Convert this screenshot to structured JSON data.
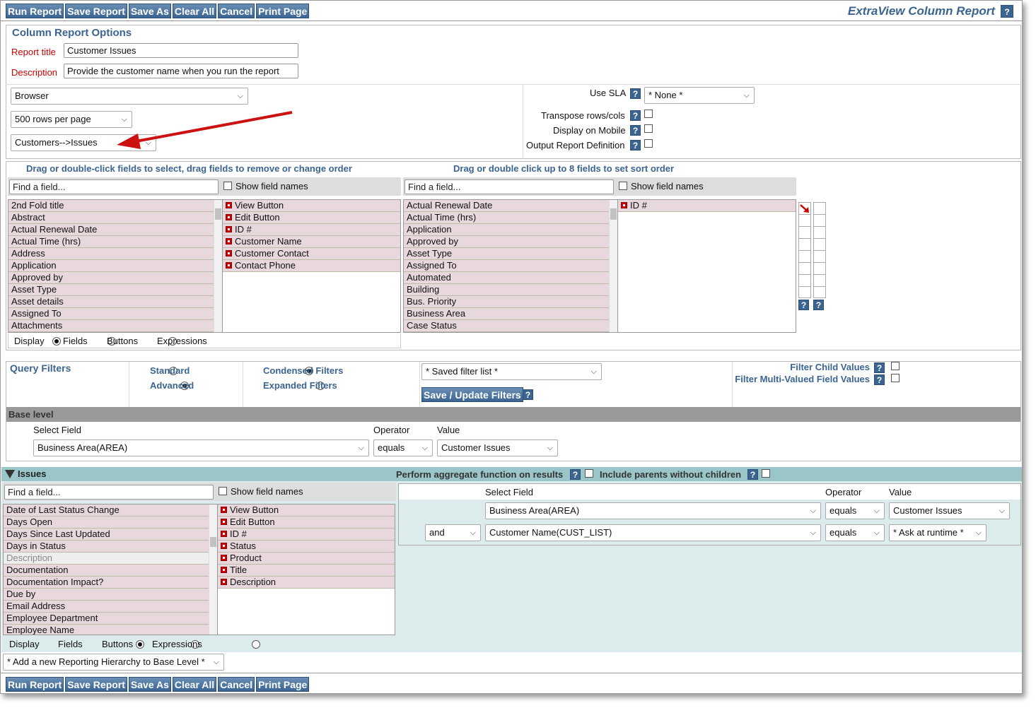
{
  "toolbar": {
    "run": "Run Report",
    "save": "Save Report",
    "saveas": "Save As",
    "clear": "Clear All",
    "cancel": "Cancel",
    "print": "Print Page"
  },
  "app_title": "ExtraView Column Report",
  "help": "?",
  "options": {
    "heading": "Column Report Options",
    "title_label": "Report title",
    "title_value": "Customer Issues",
    "desc_label": "Description",
    "desc_value": "Provide the customer name when you run the report",
    "output": "Browser",
    "rows": "500 rows per page",
    "hierarchy": "Customers-->Issues",
    "sla_label": "Use SLA",
    "sla_value": "* None *",
    "transpose": "Transpose rows/cols",
    "mobile": "Display on Mobile",
    "output_def": "Output Report Definition"
  },
  "fields": {
    "select_hint": "Drag or double-click fields to select, drag fields to remove or change order",
    "sort_hint": "Drag or double click up to 8 fields to set sort order",
    "find": "Find a field...",
    "show_names": "Show field names",
    "available": [
      "2nd Fold title",
      "Abstract",
      "Actual Renewal Date",
      "Actual Time (hrs)",
      "Address",
      "Application",
      "Approved by",
      "Asset Type",
      "Asset details",
      "Assigned To",
      "Attachments"
    ],
    "selected": [
      "View Button",
      "Edit Button",
      "ID #",
      "Customer Name",
      "Customer Contact",
      "Contact Phone"
    ],
    "sort_available": [
      "Actual Renewal Date",
      "Actual Time (hrs)",
      "Application",
      "Approved by",
      "Asset Type",
      "Assigned To",
      "Automated",
      "Building",
      "Bus. Priority",
      "Business Area",
      "Case Status"
    ],
    "sort_selected": [
      "ID #"
    ],
    "display": "Display",
    "opt_fields": "Fields",
    "opt_buttons": "Buttons",
    "opt_expr": "Expressions"
  },
  "filters": {
    "heading": "Query Filters",
    "standard": "Standard",
    "advanced": "Advanced",
    "condensed": "Condensed Filters",
    "expanded": "Expanded Filters",
    "saved": "* Saved filter list *",
    "save_update": "Save / Update Filters",
    "child": "Filter Child Values",
    "multi": "Filter Multi-Valued Field Values",
    "base_level": "Base level",
    "col_field": "Select Field",
    "col_op": "Operator",
    "col_val": "Value",
    "base_field": "Business Area(AREA)",
    "base_op": "equals",
    "base_val": "Customer Issues"
  },
  "issues": {
    "heading": "Issues",
    "aggregate": "Perform aggregate function on results",
    "include_parents": "Include parents without children",
    "available": [
      "Date of Last Status Change",
      "Days Open",
      "Days Since Last Updated",
      "Days in Status",
      "Description",
      "Documentation",
      "Documentation Impact?",
      "Due by",
      "Email Address",
      "Employee Department",
      "Employee Name"
    ],
    "selected": [
      "View Button",
      "Edit Button",
      "ID #",
      "Status",
      "Product",
      "Title",
      "Description"
    ],
    "f1_field": "Business Area(AREA)",
    "f1_op": "equals",
    "f1_val": "Customer Issues",
    "f2_conj": "and",
    "f2_field": "Customer Name(CUST_LIST)",
    "f2_op": "equals",
    "f2_val": "* Ask at runtime *"
  },
  "add_hierarchy": "* Add a new Reporting Hierarchy to Base Level *",
  "colors": {
    "accent": "#3b6491",
    "annotation_arrow": "#cc1111",
    "teal_panel": "#dcebec"
  }
}
